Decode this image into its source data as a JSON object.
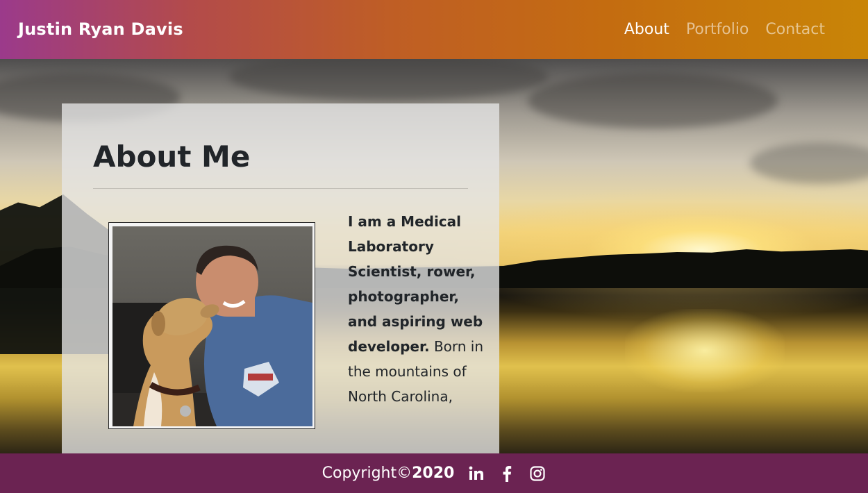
{
  "navbar": {
    "brand": "Justin Ryan Davis",
    "links": [
      {
        "label": "About",
        "active": true
      },
      {
        "label": "Portfolio",
        "active": false
      },
      {
        "label": "Contact",
        "active": false
      }
    ]
  },
  "about": {
    "title": "About Me",
    "bio_bold": "I am a Medical Laboratory Scientist, rower, photographer, and aspiring web developer.",
    "bio_rest": "Born in the mountains of North Carolina,"
  },
  "footer": {
    "copyright": "Copyright©",
    "year": "2020",
    "social_icons": [
      "linkedin-icon",
      "facebook-icon",
      "instagram-icon"
    ]
  },
  "colors": {
    "navbar_gradient_start": "#9b3a8b",
    "navbar_gradient_end": "#c98507",
    "footer": "#6b2352",
    "text_dark": "#212529"
  }
}
